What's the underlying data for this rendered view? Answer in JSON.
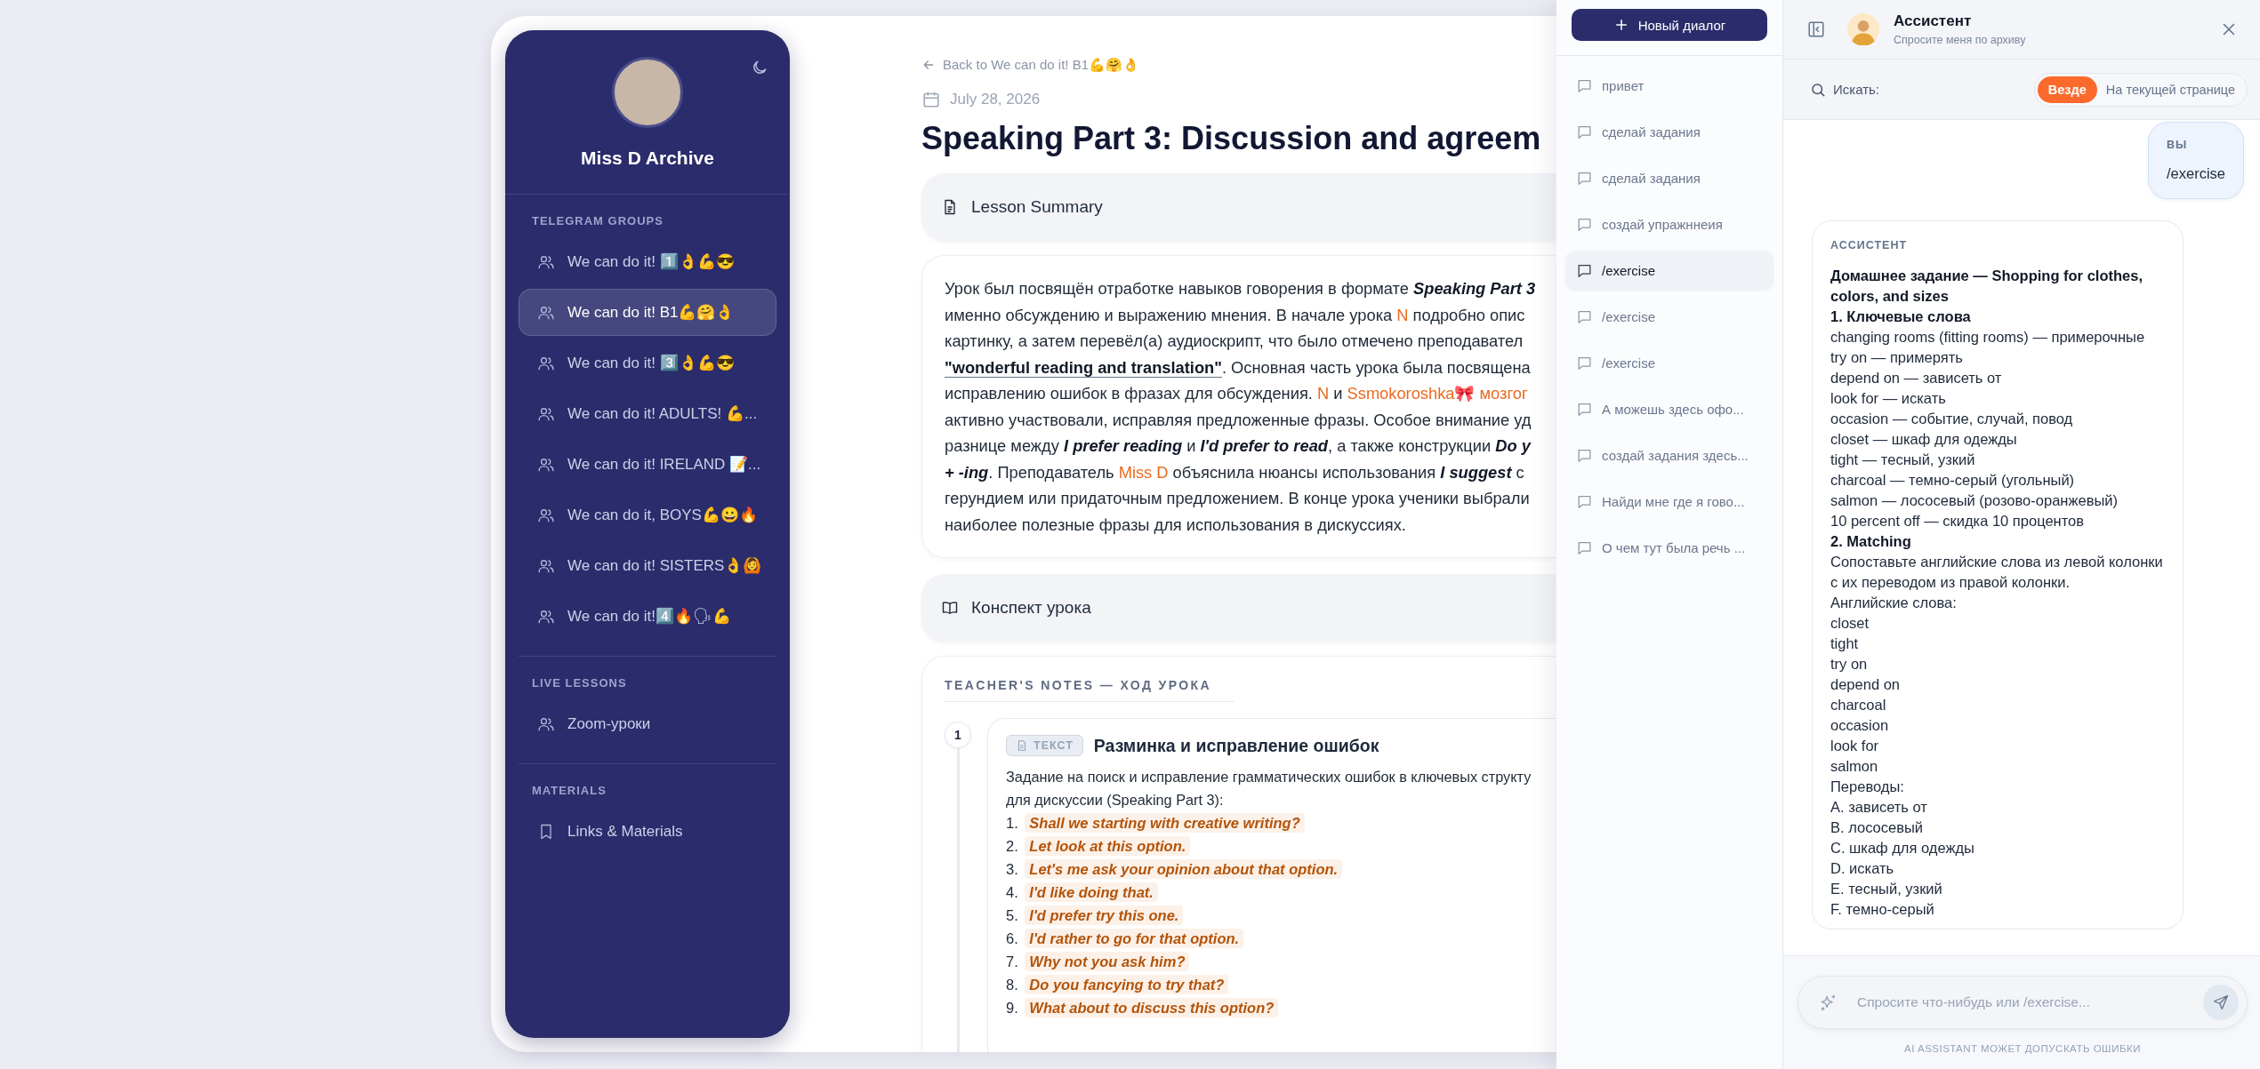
{
  "sidebar": {
    "title": "Miss D Archive",
    "sections": [
      {
        "heading": "TELEGRAM GROUPS",
        "items": [
          {
            "label": "We can do it! 1️⃣👌💪😎",
            "selected": false
          },
          {
            "label": "We can do it! B1💪🤗👌",
            "selected": true
          },
          {
            "label": "We can do it! 3️⃣👌💪😎",
            "selected": false
          },
          {
            "label": "We can do it! ADULTS! 💪...",
            "selected": false
          },
          {
            "label": "We can do it! IRELAND 📝...",
            "selected": false
          },
          {
            "label": "We can do it, BOYS💪😀🔥",
            "selected": false
          },
          {
            "label": "We can do it! SISTERS👌🙆",
            "selected": false
          },
          {
            "label": "We can do it!4️⃣🔥🗣💪",
            "selected": false
          }
        ]
      },
      {
        "heading": "LIVE LESSONS",
        "items": [
          {
            "label": "Zoom-уроки",
            "selected": false
          }
        ]
      },
      {
        "heading": "MATERIALS",
        "items": [
          {
            "label": "Links & Materials",
            "selected": false
          }
        ]
      }
    ]
  },
  "lesson": {
    "back_link": "Back to We can do it! B1💪🤗👌",
    "date": "July 28, 2026",
    "title": "Speaking Part 3: Discussion and agreem",
    "summary_header": "Lesson Summary",
    "summary_lines": [
      [
        {
          "kind": "plain",
          "text": "Урок был посвящён отработке навыков говорения в формате "
        },
        {
          "kind": "emph",
          "text": "Speaking Part 3"
        }
      ],
      [
        {
          "kind": "plain",
          "text": "именно обсуждению и выражению мнения. В начале урока "
        },
        {
          "kind": "name",
          "text": "N"
        },
        {
          "kind": "plain",
          "text": " подробно опис"
        }
      ],
      [
        {
          "kind": "plain",
          "text": "картинку, а затем перевёл(а) аудиоскрипт, что было отмечено преподавател"
        }
      ],
      [
        {
          "kind": "quote",
          "text": "\"wonderful reading and translation\""
        },
        {
          "kind": "plain",
          "text": ". Основная часть урока была посвящена"
        }
      ],
      [
        {
          "kind": "plain",
          "text": "исправлению ошибок в фразах для обсуждения. "
        },
        {
          "kind": "name",
          "text": "N"
        },
        {
          "kind": "plain",
          "text": " и "
        },
        {
          "kind": "name",
          "text": "Ssmokoroshka🎀 мозгог"
        }
      ],
      [
        {
          "kind": "plain",
          "text": "активно участвовали, исправляя предложенные фразы. Особое внимание уд"
        }
      ],
      [
        {
          "kind": "plain",
          "text": "разнице между "
        },
        {
          "kind": "emph",
          "text": "I prefer reading"
        },
        {
          "kind": "plain",
          "text": " и "
        },
        {
          "kind": "emph",
          "text": "I'd prefer to read"
        },
        {
          "kind": "plain",
          "text": ", а также конструкции "
        },
        {
          "kind": "emph",
          "text": "Do y"
        }
      ],
      [
        {
          "kind": "emph",
          "text": "+ -ing"
        },
        {
          "kind": "plain",
          "text": ". Преподаватель "
        },
        {
          "kind": "name",
          "text": "Miss D"
        },
        {
          "kind": "plain",
          "text": " объяснила нюансы использования "
        },
        {
          "kind": "emph",
          "text": "I suggest"
        },
        {
          "kind": "plain",
          "text": " с"
        }
      ],
      [
        {
          "kind": "plain",
          "text": "герундием или придаточным предложением. В конце урока ученики выбрали"
        }
      ],
      [
        {
          "kind": "plain",
          "text": "наиболее полезные фразы для использования в дискуссиях."
        }
      ]
    ],
    "notes_header": "Конспект урока",
    "teachers_notes": {
      "heading": "TEACHER'S NOTES — ХОД УРОКА",
      "steps": [
        {
          "number": "1",
          "tag": "ТЕКСТ",
          "title": "Разминка и исправление ошибок",
          "intro_lines": [
            "Задание на поиск и исправление грамматических ошибок в ключевых структу",
            "для дискуссии (Speaking Part 3):"
          ],
          "items": [
            {
              "number": "1.",
              "text": "Shall we starting with creative writing?"
            },
            {
              "number": "2.",
              "text": "Let look at this option."
            },
            {
              "number": "3.",
              "text": "Let's me ask your opinion about that option."
            },
            {
              "number": "4.",
              "text": "I'd like doing that."
            },
            {
              "number": "5.",
              "text": "I'd prefer try this one."
            },
            {
              "number": "6.",
              "text": "I'd rather to go for that option."
            },
            {
              "number": "7.",
              "text": "Why not you ask him?"
            },
            {
              "number": "8.",
              "text": "Do you fancying to try that?"
            },
            {
              "number": "9.",
              "text": "What about to discuss this option?"
            }
          ]
        }
      ]
    }
  },
  "conversations": {
    "new_button": "Новый диалог",
    "items": [
      {
        "label": "привет",
        "selected": false
      },
      {
        "label": "сделай задания",
        "selected": false
      },
      {
        "label": "сделай задания",
        "selected": false
      },
      {
        "label": "создай упражннеия",
        "selected": false
      },
      {
        "label": "/exercise",
        "selected": true
      },
      {
        "label": "/exercise",
        "selected": false
      },
      {
        "label": "/exercise",
        "selected": false
      },
      {
        "label": "А можешь здесь офо...",
        "selected": false
      },
      {
        "label": "создай задания здесь...",
        "selected": false
      },
      {
        "label": "Найди мне где я гово...",
        "selected": false
      },
      {
        "label": "О чем тут была речь ...",
        "selected": false
      }
    ]
  },
  "assistant": {
    "title": "Ассистент",
    "subtitle": "Спросите меня по архиву",
    "search_label": "Искать:",
    "scopes": [
      {
        "label": "Везде",
        "selected": true
      },
      {
        "label": "На текущей странице",
        "selected": false
      }
    ],
    "messages": [
      {
        "kind": "user",
        "author": "ВЫ",
        "lines": [
          {
            "kind": "text",
            "text": "/exercise"
          }
        ]
      },
      {
        "kind": "assistant",
        "author": "АССИСТЕНТ",
        "lines": [
          {
            "kind": "heading",
            "text": "Домашнее задание — Shopping for clothes, colors, and sizes"
          },
          {
            "kind": "heading",
            "text": "1. Ключевые слова"
          },
          {
            "kind": "text",
            "text": "changing rooms (fitting rooms) — примерочные"
          },
          {
            "kind": "text",
            "text": "try on — примерять"
          },
          {
            "kind": "text",
            "text": "depend on — зависеть от"
          },
          {
            "kind": "text",
            "text": "look for — искать"
          },
          {
            "kind": "text",
            "text": "occasion — событие, случай, повод"
          },
          {
            "kind": "text",
            "text": "closet — шкаф для одежды"
          },
          {
            "kind": "text",
            "text": "tight — тесный, узкий"
          },
          {
            "kind": "text",
            "text": "charcoal — темно-серый (угольный)"
          },
          {
            "kind": "text",
            "text": "salmon — лососевый (розово-оранжевый)"
          },
          {
            "kind": "text",
            "text": "10 percent off — скидка 10 процентов"
          },
          {
            "kind": "heading",
            "text": "2. Matching"
          },
          {
            "kind": "text",
            "text": "Сопоставьте английские слова из левой колонки с их переводом из правой колонки."
          },
          {
            "kind": "text",
            "text": "Английские слова:"
          },
          {
            "kind": "text",
            "text": "closet"
          },
          {
            "kind": "text",
            "text": "tight"
          },
          {
            "kind": "text",
            "text": "try on"
          },
          {
            "kind": "text",
            "text": "depend on"
          },
          {
            "kind": "text",
            "text": "charcoal"
          },
          {
            "kind": "text",
            "text": "occasion"
          },
          {
            "kind": "text",
            "text": "look for"
          },
          {
            "kind": "text",
            "text": "salmon"
          },
          {
            "kind": "text",
            "text": "Переводы:"
          },
          {
            "kind": "text",
            "text": "A. зависеть от"
          },
          {
            "kind": "text",
            "text": "B. лососевый"
          },
          {
            "kind": "text",
            "text": "C. шкаф для одежды"
          },
          {
            "kind": "text",
            "text": "D. искать"
          },
          {
            "kind": "text",
            "text": "E. тесный, узкий"
          },
          {
            "kind": "text",
            "text": "F. темно-серый"
          }
        ]
      }
    ],
    "input": {
      "placeholder": "Спросите что-нибудь или /exercise..."
    },
    "disclaimer": "AI ASSISTANT МОЖЕТ ДОПУСКАТЬ ОШИБКИ"
  }
}
